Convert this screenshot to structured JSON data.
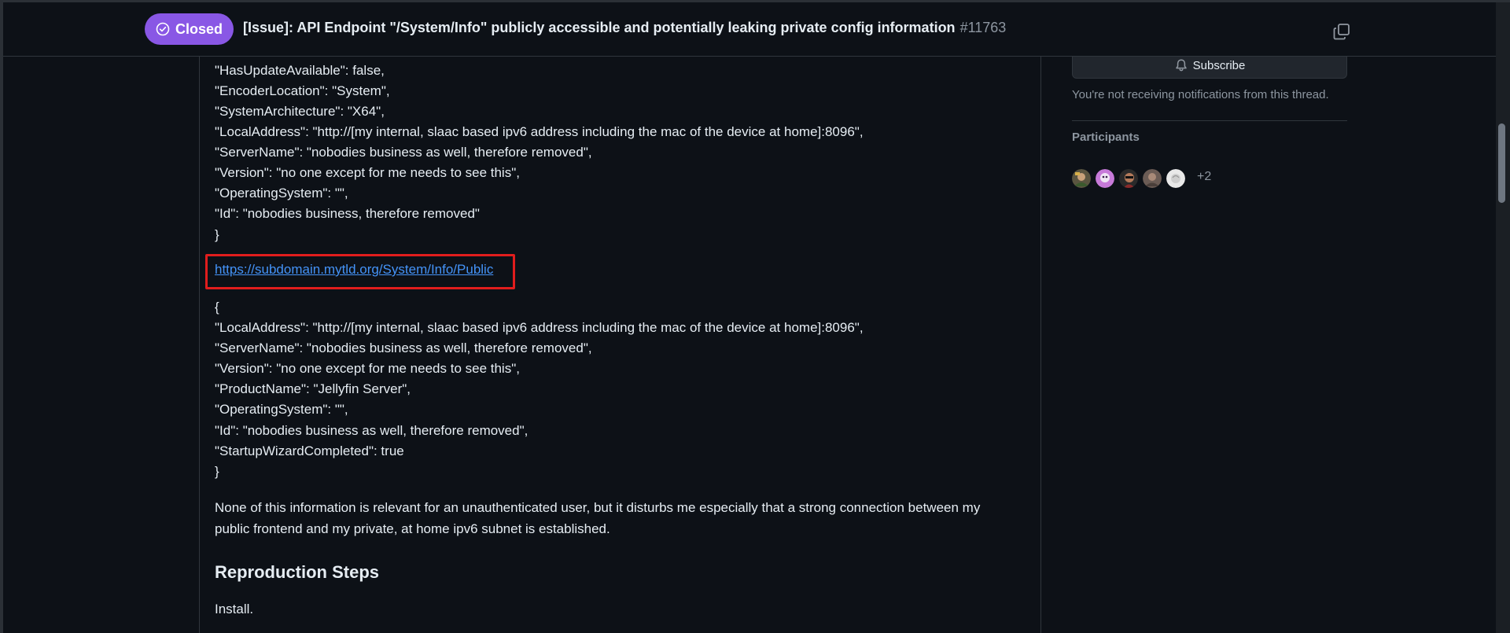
{
  "header": {
    "state_label": "Closed",
    "title": "[Issue]: API Endpoint \"/System/Info\" publicly accessible and potentially leaking private config information",
    "number": "#11763"
  },
  "body": {
    "json1_lines": [
      "\"HasUpdateAvailable\": false,",
      "\"EncoderLocation\": \"System\",",
      "\"SystemArchitecture\": \"X64\",",
      "\"LocalAddress\": \"http://[my internal, slaac based ipv6 address including the mac of the device at home]:8096\",",
      "\"ServerName\": \"nobodies business as well, therefore removed\",",
      "\"Version\": \"no one except for me needs to see this\",",
      "\"OperatingSystem\": \"\",",
      "\"Id\": \"nobodies business, therefore removed\"",
      "}"
    ],
    "link_text": "https://subdomain.mytld.org/System/Info/Public",
    "json2_lines": [
      "{",
      "\"LocalAddress\": \"http://[my internal, slaac based ipv6 address including the mac of the device at home]:8096\",",
      "\"ServerName\": \"nobodies business as well, therefore removed\",",
      "\"Version\": \"no one except for me needs to see this\",",
      "\"ProductName\": \"Jellyfin Server\",",
      "\"OperatingSystem\": \"\",",
      "\"Id\": \"nobodies business as well, therefore removed\",",
      "\"StartupWizardCompleted\": true",
      "}"
    ],
    "paragraph": "None of this information is relevant for an unauthenticated user, but it disturbs me especially that a strong connection between my public frontend and my private, at home ipv6 subnet is established.",
    "section_heading": "Reproduction Steps",
    "install_text": "Install."
  },
  "sidebar": {
    "subscribe_label": "Subscribe",
    "notification_text": "You're not receiving notifications from this thread.",
    "participants_heading": "Participants",
    "participants_more": "+2"
  },
  "colors": {
    "closed_badge": "#8957e5",
    "link": "#4493f8",
    "highlight_box": "#e11d1d",
    "background": "#0d1117"
  }
}
